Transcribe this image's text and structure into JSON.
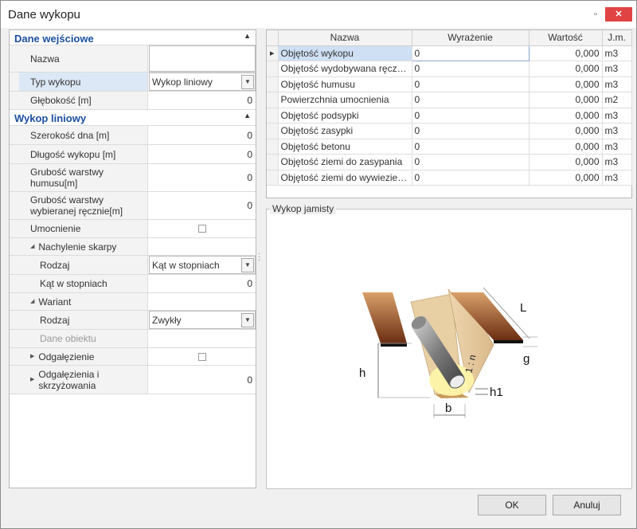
{
  "window": {
    "title": "Dane wykopu",
    "minimize_glyph": "▫",
    "close_glyph": "✕"
  },
  "props": {
    "section1": "Dane wejściowe",
    "nazwa_label": "Nazwa",
    "nazwa_value": "",
    "typ_label": "Typ wykopu",
    "typ_value": "Wykop liniowy",
    "glebokosc_label": "Głębokość [m]",
    "glebokosc_value": "0",
    "section2": "Wykop liniowy",
    "szerokosc_label": "Szerokość dna [m]",
    "szerokosc_value": "0",
    "dlugosc_label": "Długość wykopu [m]",
    "dlugosc_value": "0",
    "humus_label": "Grubość warstwy humusu[m]",
    "humus_value": "0",
    "reczna_label": "Grubość warstwy wybieranej ręcznie[m]",
    "reczna_value": "0",
    "umocnienie_label": "Umocnienie",
    "nachylenie_label": "Nachylenie skarpy",
    "rodzaj1_label": "Rodzaj",
    "rodzaj1_value": "Kąt w stopniach",
    "kat_label": "Kąt w stopniach",
    "kat_value": "0",
    "wariant_label": "Wariant",
    "rodzaj2_label": "Rodzaj",
    "rodzaj2_value": "Zwykły",
    "dane_label": "Dane obiektu",
    "odgalezienie_label": "Odgałęzienie",
    "odgalezienia_label": "Odgałęzienia i skrzyżowania",
    "odgalezienia_value": "0"
  },
  "grid": {
    "headers": [
      "Nazwa",
      "Wyrażenie",
      "Wartość",
      "J.m."
    ],
    "rows": [
      {
        "name": "Objętość wykopu",
        "expr": "0",
        "value": "0,000",
        "unit": "m3"
      },
      {
        "name": "Objętość wydobywana ręcznie",
        "expr": "0",
        "value": "0,000",
        "unit": "m3"
      },
      {
        "name": "Objętość humusu",
        "expr": "0",
        "value": "0,000",
        "unit": "m3"
      },
      {
        "name": "Powierzchnia umocnienia",
        "expr": "0",
        "value": "0,000",
        "unit": "m2"
      },
      {
        "name": "Objętość podsypki",
        "expr": "0",
        "value": "0,000",
        "unit": "m3"
      },
      {
        "name": "Objętość zasypki",
        "expr": "0",
        "value": "0,000",
        "unit": "m3"
      },
      {
        "name": "Objętość betonu",
        "expr": "0",
        "value": "0,000",
        "unit": "m3"
      },
      {
        "name": "Objętość ziemi do zasypania",
        "expr": "0",
        "value": "0,000",
        "unit": "m3"
      },
      {
        "name": "Objętość ziemi do wywiezienia",
        "expr": "0",
        "value": "0,000",
        "unit": "m3"
      }
    ]
  },
  "figure": {
    "group_title": "Wykop jamisty",
    "labels": {
      "L": "L",
      "g": "g",
      "h": "h",
      "h1": "h1",
      "b": "b",
      "slope": "1 : n"
    }
  },
  "buttons": {
    "ok": "OK",
    "cancel": "Anuluj"
  }
}
